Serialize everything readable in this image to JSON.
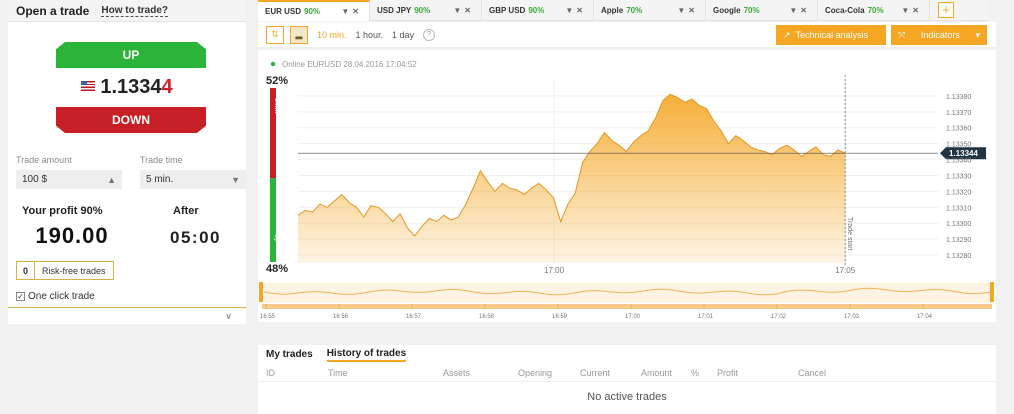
{
  "left_panel": {
    "title": "Open a trade",
    "how_link": "How to trade?",
    "up_label": "UP",
    "down_label": "DOWN",
    "price_main": "1.1334",
    "price_last": "4",
    "trade_amount_label": "Trade amount",
    "trade_amount_value": "100 $",
    "trade_time_label": "Trade time",
    "trade_time_value": "5 min.",
    "profit_label": "Your profit 90%",
    "profit_value": "190.00",
    "after_label": "After",
    "after_value": "05:00",
    "risk_free_count": "0",
    "risk_free_label": "Risk-free trades",
    "one_click_label": "One click trade",
    "one_click_checked": true
  },
  "tabs": [
    {
      "name": "EUR USD",
      "pct": "90%"
    },
    {
      "name": "USD JPY",
      "pct": "90%"
    },
    {
      "name": "GBP USD",
      "pct": "90%"
    },
    {
      "name": "Apple",
      "pct": "70%"
    },
    {
      "name": "Google",
      "pct": "70%"
    },
    {
      "name": "Coca-Cola",
      "pct": "70%"
    }
  ],
  "toolbar": {
    "timeframes": [
      "10 min.",
      "1 hour.",
      "1 day"
    ],
    "active_timeframe": "10 min.",
    "technical_analysis": "Technical analysis",
    "indicators": "Indicators"
  },
  "chart": {
    "status": "Online EURUSD 28.04.2016 17:04:52",
    "pct_top": "52%",
    "pct_bottom": "48%",
    "down_label": "Down",
    "up_label": "Up",
    "trade_start_label": "Trade start",
    "current_price_tag": "1.13344",
    "accent_color": "#f5a623",
    "up_color": "#2bb33a",
    "down_color": "#c62026"
  },
  "chart_data": {
    "type": "area",
    "ylim": [
      1.13275,
      1.1339
    ],
    "y_ticks": [
      "1.13380",
      "1.13370",
      "1.13360",
      "1.13350",
      "1.13340",
      "1.13330",
      "1.13320",
      "1.13310",
      "1.13300",
      "1.13290",
      "1.13280"
    ],
    "y_tick_values": [
      1.1338,
      1.1337,
      1.1336,
      1.1335,
      1.1334,
      1.1333,
      1.1332,
      1.1331,
      1.133,
      1.1329,
      1.1328
    ],
    "x_ticks": [
      {
        "label": "17:00",
        "t": 0.4
      },
      {
        "label": "17:05",
        "t": 0.855
      }
    ],
    "trade_start_t": 0.855,
    "current_price": 1.13344,
    "series": [
      {
        "values": [
          1.13305,
          1.13308,
          1.13307,
          1.13312,
          1.1331,
          1.13314,
          1.13318,
          1.13313,
          1.1331,
          1.13304,
          1.13311,
          1.1331,
          1.13306,
          1.13301,
          1.13306,
          1.13297,
          1.13292,
          1.13298,
          1.13303,
          1.13301,
          1.13305,
          1.13302,
          1.13304,
          1.13312,
          1.13322,
          1.13333,
          1.13326,
          1.1332,
          1.13325,
          1.13322,
          1.13321,
          1.13318,
          1.13322,
          1.13325,
          1.13321,
          1.13316,
          1.13301,
          1.13312,
          1.13319,
          1.13338,
          1.13345,
          1.1335,
          1.13357,
          1.13352,
          1.13349,
          1.13345,
          1.13351,
          1.13355,
          1.13358,
          1.13366,
          1.13377,
          1.13381,
          1.13379,
          1.13376,
          1.13378,
          1.13374,
          1.13372,
          1.13364,
          1.13358,
          1.1335,
          1.13355,
          1.13352,
          1.13348,
          1.13346,
          1.13345,
          1.13343,
          1.13347,
          1.13349,
          1.13346,
          1.13342,
          1.13345,
          1.13348,
          1.13343,
          1.13342,
          1.13346,
          1.13344
        ]
      }
    ]
  },
  "navigator": {
    "times": [
      "16:55",
      "16:56",
      "16:57",
      "16:58",
      "16:59",
      "17:00",
      "17:01",
      "17:02",
      "17:03",
      "17:04"
    ]
  },
  "trades": {
    "my_trades": "My trades",
    "history": "History of trades",
    "columns": [
      "ID",
      "Time",
      "Assets",
      "Opening",
      "Current",
      "Amount",
      "%",
      "Profit",
      "Cancel"
    ],
    "empty": "No active trades"
  }
}
